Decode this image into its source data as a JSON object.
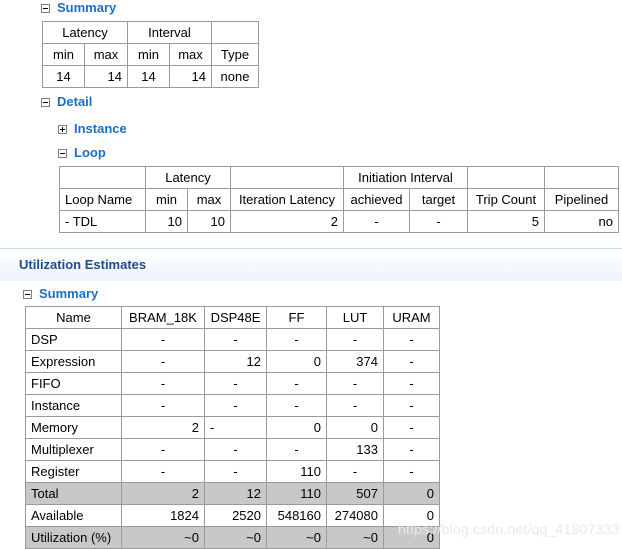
{
  "perf": {
    "summary_title": "Summary",
    "summary_table": {
      "group_headers": [
        "Latency",
        "Interval"
      ],
      "col_headers": [
        "min",
        "max",
        "min",
        "max",
        "Type"
      ],
      "row": [
        "14",
        "14",
        "14",
        "14",
        "none"
      ]
    },
    "detail_title": "Detail",
    "instance_title": "Instance",
    "loop_title": "Loop",
    "loop_table": {
      "group_headers": [
        "Latency",
        "Initiation Interval"
      ],
      "col_headers": [
        "Loop Name",
        "min",
        "max",
        "Iteration Latency",
        "achieved",
        "target",
        "Trip Count",
        "Pipelined"
      ],
      "row": [
        "- TDL",
        "10",
        "10",
        "2",
        "-",
        "-",
        "5",
        "no"
      ]
    }
  },
  "util": {
    "section_title": "Utilization Estimates",
    "summary_title": "Summary",
    "headers": [
      "Name",
      "BRAM_18K",
      "DSP48E",
      "FF",
      "LUT",
      "URAM"
    ],
    "rows": [
      [
        "DSP",
        "-",
        "-",
        "-",
        "-",
        "-"
      ],
      [
        "Expression",
        "-",
        "12",
        "0",
        "374",
        "-"
      ],
      [
        "FIFO",
        "-",
        "-",
        "-",
        "-",
        "-"
      ],
      [
        "Instance",
        "-",
        "-",
        "-",
        "-",
        "-"
      ],
      [
        "Memory",
        "2",
        "-",
        "0",
        "0",
        "-"
      ],
      [
        "Multiplexer",
        "-",
        "-",
        "-",
        "133",
        "-"
      ],
      [
        "Register",
        "-",
        "-",
        "110",
        "-",
        "-"
      ],
      [
        "Total",
        "2",
        "12",
        "110",
        "507",
        "0"
      ],
      [
        "Available",
        "1824",
        "2520",
        "548160",
        "274080",
        "0"
      ],
      [
        "Utilization (%)",
        "~0",
        "~0",
        "~0",
        "~0",
        "0"
      ]
    ]
  },
  "watermark": "https://blog.csdn.net/qq_41907333"
}
